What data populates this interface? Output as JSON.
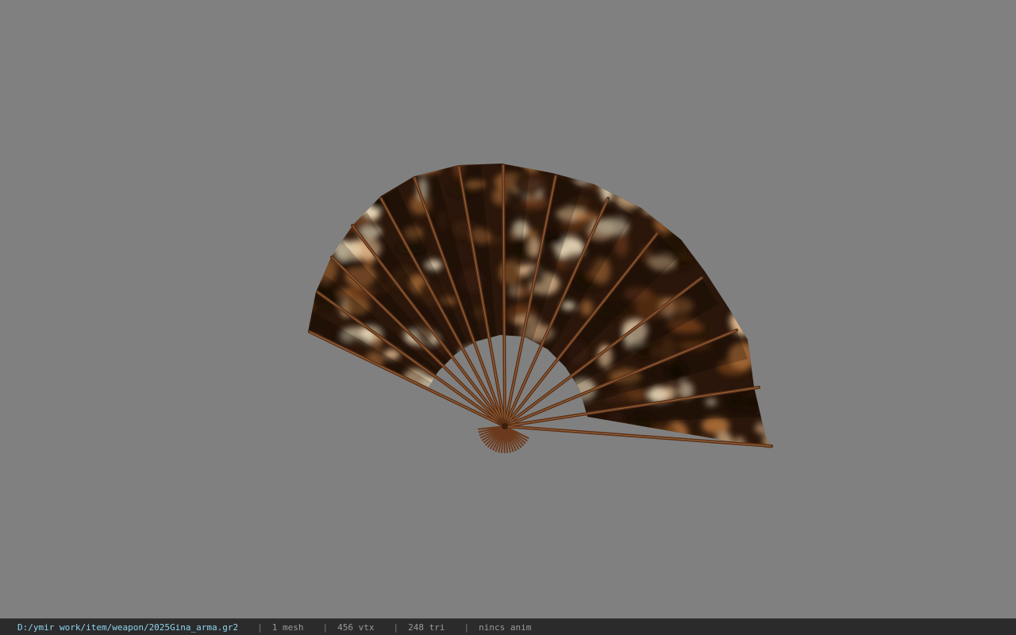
{
  "viewport": {
    "background": "#808080",
    "model": {
      "name": "folding-fan",
      "texture": "leopard-print",
      "rib_color": "#5a3118",
      "palette": [
        "#1a0d05",
        "#3b200e",
        "#6b3a18",
        "#a66a36",
        "#d9b48a",
        "#f0e0c0"
      ]
    }
  },
  "status_bar": {
    "file_path": "D:/ymir work/item/weapon/2025Gina_arma.gr2",
    "separator": "|",
    "mesh_count": "1 mesh",
    "vertex_count": "456 vtx",
    "triangle_count": "248 tri",
    "animation": "nincs anim"
  }
}
